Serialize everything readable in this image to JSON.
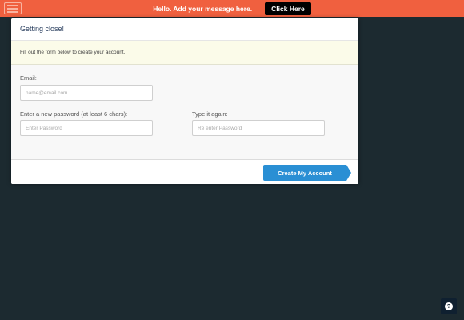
{
  "topbar": {
    "logo_icon": "hellobar-logo-icon",
    "message": "Hello. Add your message here.",
    "button_label": "Click Here",
    "background": "#f0603f"
  },
  "modal": {
    "title": "Getting close!",
    "notice": "Fill out the form below to create your account.",
    "email": {
      "label": "Email:",
      "placeholder": "name@email.com",
      "value": ""
    },
    "password": {
      "label": "Enter a new password (at least 6 chars):",
      "placeholder": "Enter Password",
      "value": ""
    },
    "password_confirm": {
      "label": "Type it again:",
      "placeholder": "Re enter Password",
      "value": ""
    },
    "submit_label": "Create My Account",
    "accent": "#2a8fd4"
  },
  "help": {
    "icon": "question-icon",
    "glyph": "?"
  }
}
